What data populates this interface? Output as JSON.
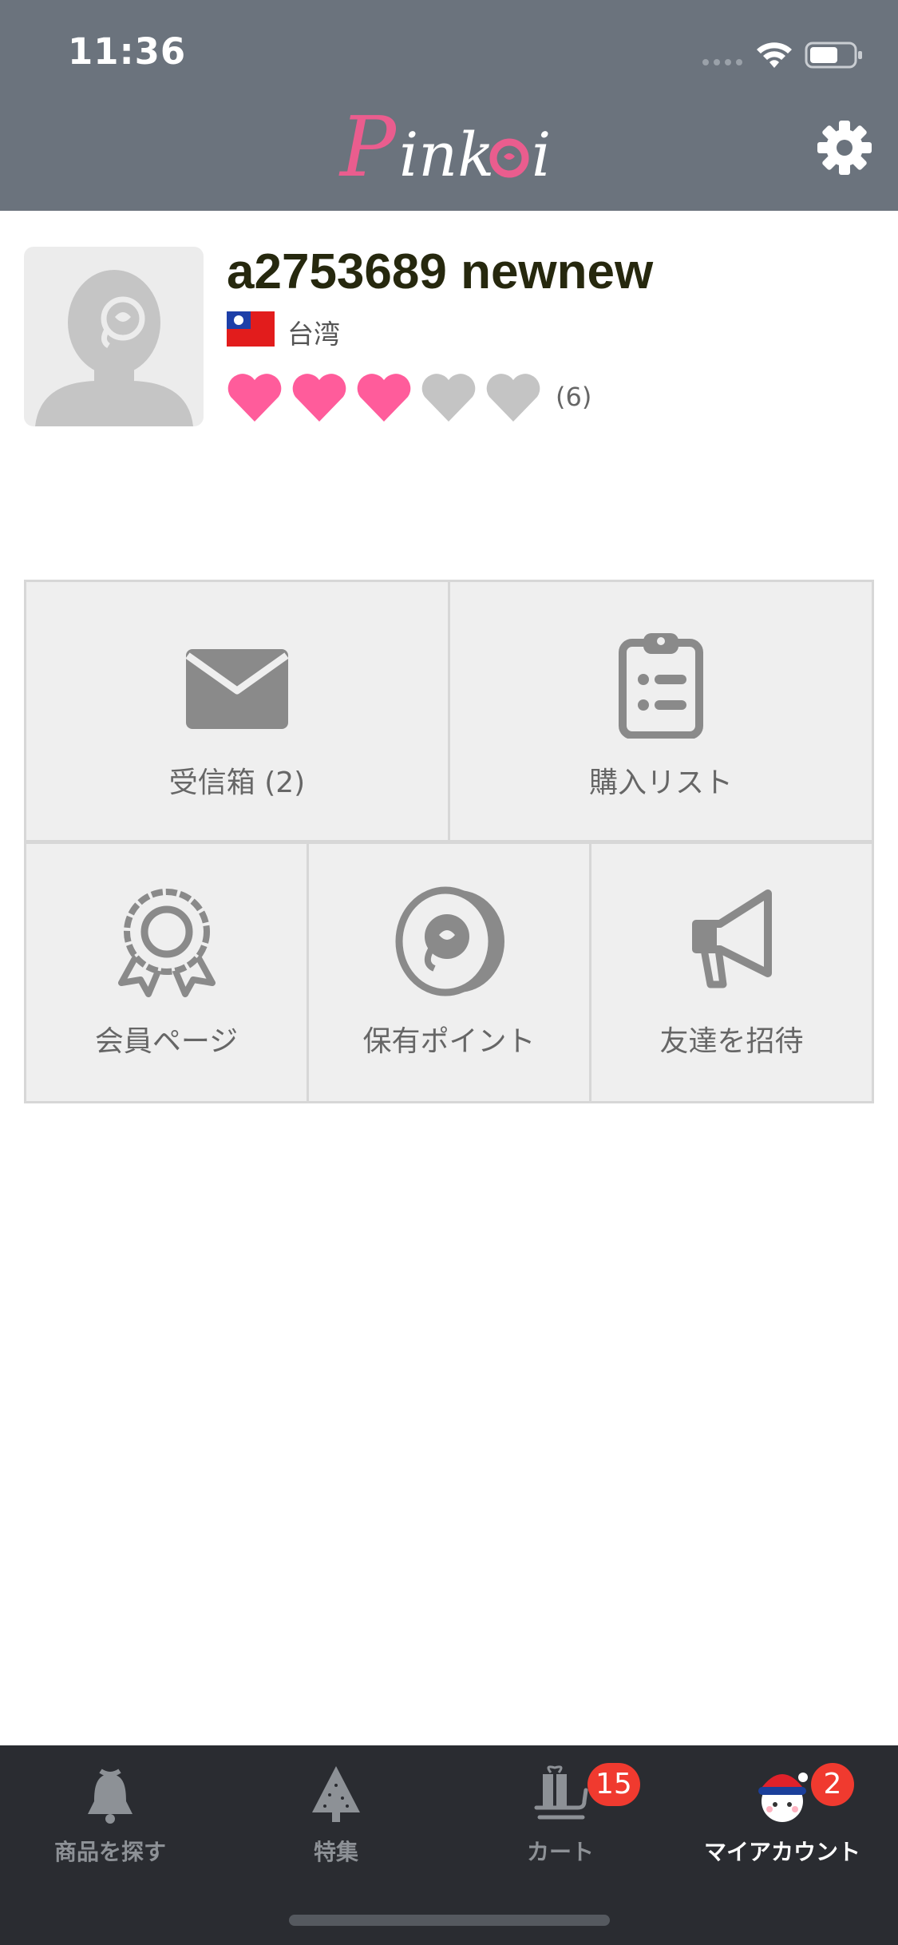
{
  "status_bar": {
    "time": "11:36"
  },
  "header": {
    "logo_text": "Pinkoi",
    "brand_color": "#ea5d8e",
    "settings_icon": "gear-icon"
  },
  "profile": {
    "username": "a2753689 newnew",
    "country": "台湾",
    "country_flag_icon": "taiwan-flag-icon",
    "rating": {
      "filled": 3,
      "total": 5,
      "count_text": "(6)"
    },
    "heart_color_filled": "#ff5c9b",
    "heart_color_empty": "#c4c4c4"
  },
  "menu": {
    "inbox": {
      "label": "受信箱 (2)",
      "icon": "envelope-icon"
    },
    "purchases": {
      "label": "購入リスト",
      "icon": "clipboard-icon"
    },
    "membership": {
      "label": "会員ページ",
      "icon": "award-badge-icon"
    },
    "points": {
      "label": "保有ポイント",
      "icon": "coin-icon"
    },
    "invite": {
      "label": "友達を招待",
      "icon": "megaphone-icon"
    }
  },
  "tabbar": {
    "tabs": [
      {
        "label": "商品を探す",
        "icon": "bell-icon",
        "active": false
      },
      {
        "label": "特集",
        "icon": "christmas-tree-icon",
        "active": false
      },
      {
        "label": "カート",
        "icon": "cart-sleigh-icon",
        "active": false,
        "badge": "15"
      },
      {
        "label": "マイアカウント",
        "icon": "avatar-santa-icon",
        "active": true,
        "badge": "2"
      }
    ],
    "badge_color": "#f03a2f"
  }
}
